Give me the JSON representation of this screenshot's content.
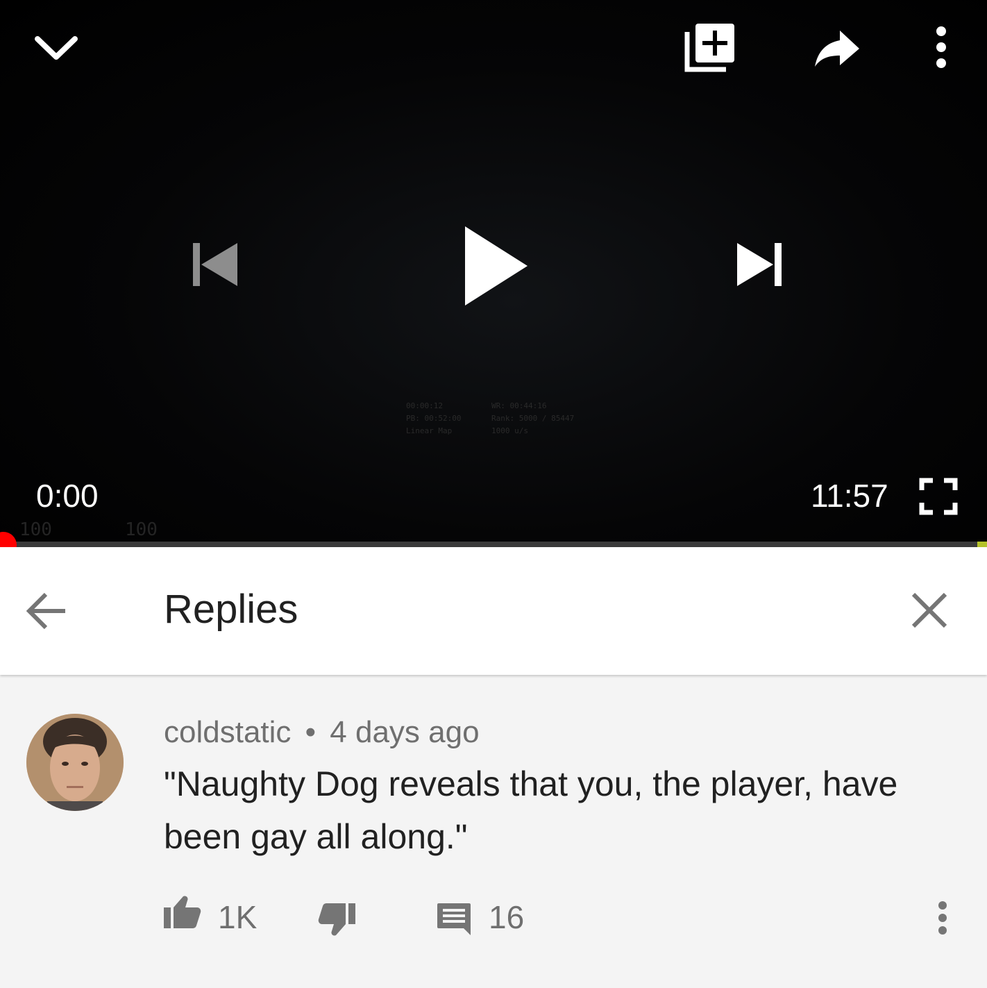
{
  "player": {
    "current_time": "0:00",
    "duration": "11:57",
    "progress_fraction": 0.0,
    "hud_left": [
      "00:00:12",
      "PB: 00:52:00",
      "Linear Map"
    ],
    "hud_right": [
      "WR: 00:44:16",
      "Rank: 5000 / 85447",
      "1000 u/s"
    ],
    "hud_health_1": "100",
    "hud_health_2": "100",
    "icons": {
      "collapse": "chevron-down-icon",
      "add_to_playlist": "add-to-playlist-icon",
      "share": "share-icon",
      "more": "more-vertical-icon",
      "previous": "skip-previous-icon",
      "play": "play-icon",
      "next": "skip-next-icon",
      "fullscreen": "fullscreen-icon"
    },
    "colors": {
      "progress": "#ff0000",
      "track": "#3a3a3a"
    }
  },
  "replies_panel": {
    "title": "Replies",
    "icons": {
      "back": "arrow-back-icon",
      "close": "close-icon"
    }
  },
  "comment": {
    "author": "coldstatic",
    "separator": "•",
    "age": "4 days ago",
    "text": "\"Naughty Dog reveals that you, the player, have been gay all along.\"",
    "likes": "1K",
    "replies": "16",
    "icons": {
      "like": "thumbs-up-icon",
      "dislike": "thumbs-down-icon",
      "reply": "comment-icon",
      "more": "more-vertical-icon"
    }
  }
}
